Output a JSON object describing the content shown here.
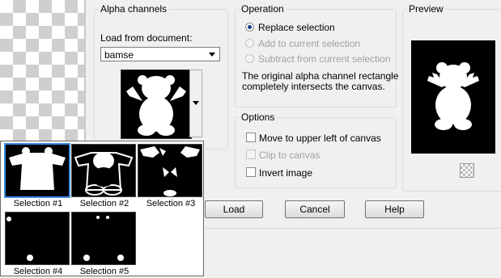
{
  "alpha_channels": {
    "title": "Alpha channels",
    "load_label": "Load from document:",
    "document_value": "bamse"
  },
  "operation": {
    "title": "Operation",
    "options": [
      "Replace selection",
      "Add to current selection",
      "Subtract from current selection"
    ],
    "selected": "Replace selection",
    "note_line1": "The original alpha channel rectangle",
    "note_line2": "completely intersects the canvas."
  },
  "options": {
    "title": "Options",
    "items": [
      "Move to upper left of canvas",
      "Clip to canvas",
      "Invert image"
    ]
  },
  "preview": {
    "title": "Preview"
  },
  "buttons": {
    "load": "Load",
    "cancel": "Cancel",
    "help": "Help"
  },
  "popup": {
    "selections": [
      "Selection #1",
      "Selection #2",
      "Selection #3",
      "Selection #4",
      "Selection #5"
    ],
    "selected": "Selection #1"
  },
  "icons": {
    "transparency_toggle": "checkerboard-icon",
    "combo_arrow": "chevron-down-icon"
  }
}
